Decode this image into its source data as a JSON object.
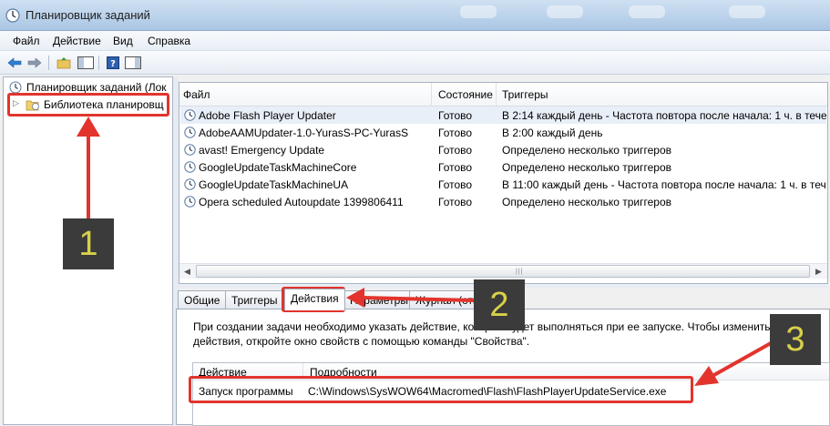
{
  "window": {
    "title": "Планировщик заданий"
  },
  "menu": [
    "Файл",
    "Действие",
    "Вид",
    "Справка"
  ],
  "toolbar": {
    "icons": [
      "back-arrow-icon",
      "forward-arrow-icon",
      "up-folder-icon",
      "show-hide-tree-icon",
      "help-icon",
      "action-pane-icon"
    ]
  },
  "tree": {
    "root": "Планировщик заданий (Лок",
    "library": "Библиотека планировщ"
  },
  "task_grid": {
    "columns": [
      "Файл",
      "Состояние",
      "Триггеры"
    ],
    "rows": [
      {
        "name": "Adobe Flash Player Updater",
        "state": "Готово",
        "trigger": "В 2:14 каждый день - Частота повтора после начала: 1 ч. в течен"
      },
      {
        "name": "AdobeAAMUpdater-1.0-YurasS-PC-YurasS",
        "state": "Готово",
        "trigger": "В 2:00 каждый день"
      },
      {
        "name": "avast! Emergency Update",
        "state": "Готово",
        "trigger": "Определено несколько триггеров"
      },
      {
        "name": "GoogleUpdateTaskMachineCore",
        "state": "Готово",
        "trigger": "Определено несколько триггеров"
      },
      {
        "name": "GoogleUpdateTaskMachineUA",
        "state": "Готово",
        "trigger": "В 11:00 каждый день - Частота повтора после начала: 1 ч. в течен"
      },
      {
        "name": "Opera scheduled Autoupdate 1399806411",
        "state": "Готово",
        "trigger": "Определено несколько триггеров"
      }
    ]
  },
  "tabs": {
    "general": "Общие",
    "triggers": "Триггеры",
    "actions": "Действия",
    "conditions": "Параметры",
    "log": "Журнал (отключен)"
  },
  "actions_tab": {
    "description": "При создании задачи необходимо указать действие, которое будет выполняться при ее запуске.  Чтобы изменить эти действия, откройте окно свойств с помощью команды \"Свойства\".",
    "columns": [
      "Действие",
      "Подробности"
    ],
    "row": {
      "action": "Запуск программы",
      "details": "C:\\Windows\\SysWOW64\\Macromed\\Flash\\FlashPlayerUpdateService.exe"
    }
  },
  "callouts": [
    "1",
    "2",
    "3"
  ],
  "colors": {
    "highlight": "#e2342d",
    "callout_bg": "#3b3b3b",
    "callout_text": "#d8d04a",
    "selection": "#e9eff8"
  }
}
